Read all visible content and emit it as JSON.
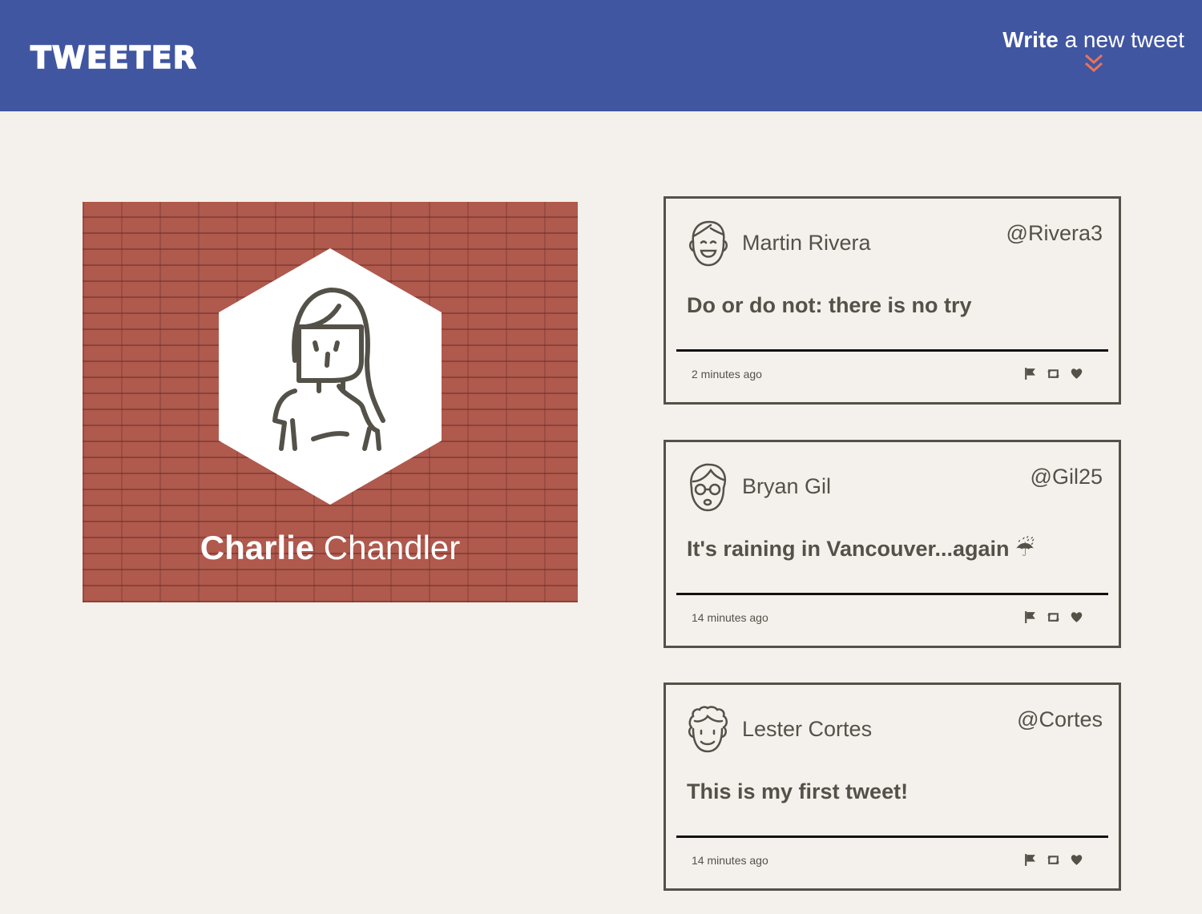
{
  "navbar": {
    "brand": "TWEETER",
    "compose_bold": "Write",
    "compose_rest": " a new tweet",
    "compose_icon": "double-chevron-down-icon",
    "background": "#4056a1",
    "accent": "#e8745a"
  },
  "profile": {
    "first_name": "Charlie",
    "last_name": " Chandler",
    "avatar_icon": "woman-avatar-icon",
    "background": "#b0594d"
  },
  "tweets": [
    {
      "name": "Martin Rivera",
      "handle": "@Rivera3",
      "content": "Do or do not: there is no try",
      "time": "2 minutes ago",
      "avatar_icon": "smiling-man-avatar-icon"
    },
    {
      "name": "Bryan Gil",
      "handle": "@Gil25",
      "content": "It's raining in Vancouver...again ☔",
      "time": "14 minutes ago",
      "avatar_icon": "glasses-man-avatar-icon"
    },
    {
      "name": "Lester Cortes",
      "handle": "@Cortes",
      "content": "This is my first tweet!",
      "time": "14 minutes ago",
      "avatar_icon": "curly-hair-man-avatar-icon"
    }
  ],
  "tweet_actions": [
    "flag-icon",
    "retweet-icon",
    "heart-icon"
  ]
}
